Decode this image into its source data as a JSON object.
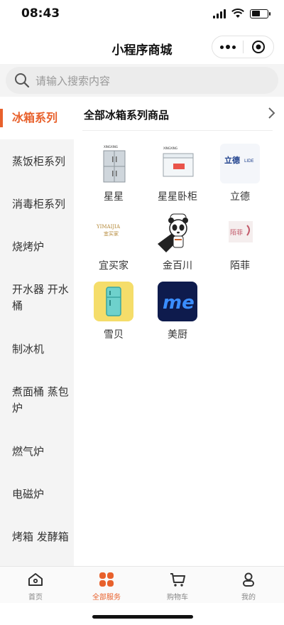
{
  "status_bar": {
    "time": "08:43"
  },
  "nav": {
    "title": "小程序商城"
  },
  "search": {
    "placeholder": "请输入搜索内容"
  },
  "sidebar": {
    "items": [
      {
        "label": "冰箱系列",
        "active": true
      },
      {
        "label": "蒸饭柜系列"
      },
      {
        "label": "消毒柜系列"
      },
      {
        "label": "烧烤炉"
      },
      {
        "label": "开水器 开水桶"
      },
      {
        "label": "制冰机"
      },
      {
        "label": "煮面桶 蒸包炉"
      },
      {
        "label": "燃气炉"
      },
      {
        "label": "电磁炉"
      },
      {
        "label": "烤箱 发酵箱"
      }
    ]
  },
  "content": {
    "title": "全部冰箱系列商品",
    "brands": [
      {
        "name": "星星",
        "icon": "upright-fridge"
      },
      {
        "name": "星星卧柜",
        "icon": "chest-freezer"
      },
      {
        "name": "立德",
        "icon": "lide-logo",
        "logo_text": "立德 LIDE"
      },
      {
        "name": "宜买家",
        "icon": "yimaijia-logo",
        "logo_text": "YIMAIJIA 宜买家"
      },
      {
        "name": "金百川",
        "icon": "panda-chef"
      },
      {
        "name": "陌菲",
        "icon": "mofei-logo",
        "logo_text": "陌菲"
      },
      {
        "name": "雪贝",
        "icon": "fridge-app-icon"
      },
      {
        "name": "美厨",
        "icon": "meichu-logo",
        "logo_text": "me"
      }
    ]
  },
  "tabbar": {
    "items": [
      {
        "label": "首页",
        "icon": "home-icon"
      },
      {
        "label": "全部服务",
        "icon": "grid-icon",
        "active": true
      },
      {
        "label": "购物车",
        "icon": "cart-icon"
      },
      {
        "label": "我的",
        "icon": "profile-icon"
      }
    ]
  },
  "colors": {
    "accent": "#e8612c",
    "sidebar_bg": "#f4f4f4"
  }
}
